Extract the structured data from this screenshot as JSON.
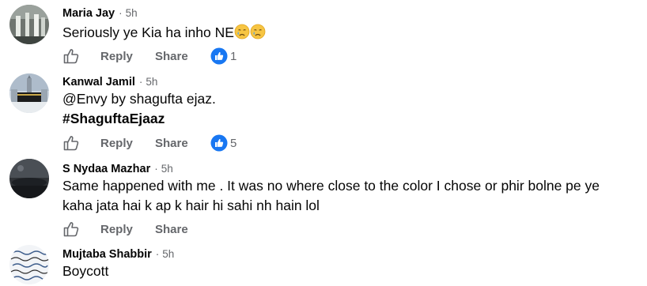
{
  "comments": [
    {
      "author": "Maria Jay",
      "time": "5h",
      "text": "Seriously ye Kia ha inho NE",
      "emojis": [
        "crying-face",
        "crying-face"
      ],
      "actions": {
        "reply": "Reply",
        "share": "Share"
      },
      "reaction_count": "1"
    },
    {
      "author": "Kanwal Jamil",
      "time": "5h",
      "text_line1": "@Envy by shagufta ejaz.",
      "hashtag": "#ShaguftaEjaaz",
      "actions": {
        "reply": "Reply",
        "share": "Share"
      },
      "reaction_count": "5"
    },
    {
      "author": "S Nydaa Mazhar",
      "time": "5h",
      "text_line1": "Same happened with me . It was no where close to the color I chose or phir bolne pe ye",
      "text_line2": "kaha jata hai k ap k hair hi sahi nh hain lol",
      "actions": {
        "reply": "Reply",
        "share": "Share"
      }
    },
    {
      "author": "Mujtaba Shabbir",
      "time": "5h",
      "text": "Boycott"
    }
  ],
  "separator": "·",
  "colors": {
    "meta": "#65676b",
    "like_blue": "#1877f2",
    "text": "#050505"
  }
}
